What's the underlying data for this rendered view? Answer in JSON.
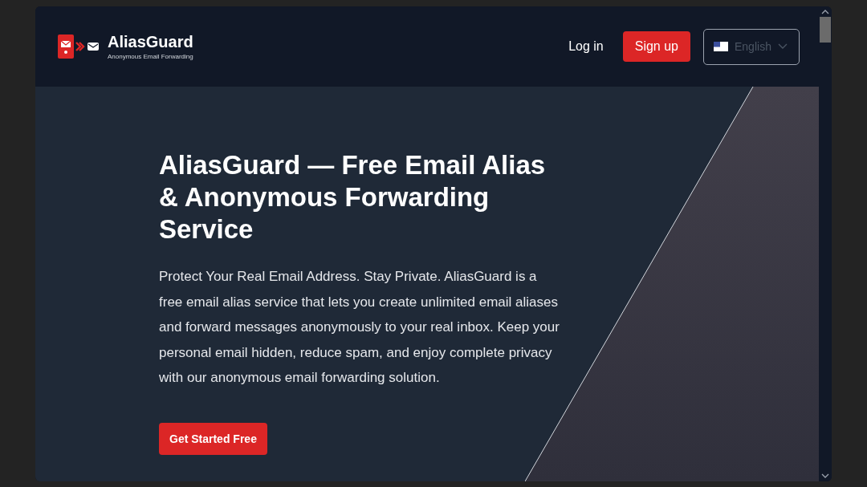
{
  "header": {
    "brand": "AliasGuard",
    "tagline": "Anonymous Email Forwarding",
    "login": "Log in",
    "signup": "Sign up",
    "language": {
      "value": "English",
      "disabled": true
    }
  },
  "hero": {
    "title": "AliasGuard — Free Email Alias & Anonymous Forwarding Service",
    "text": "Protect Your Real Email Address. Stay Private. AliasGuard is a free email alias service that lets you create unlimited email aliases and forward messages anonymously to your real inbox. Keep your personal email hidden, reduce spam, and enjoy complete privacy with our anonymous email forwarding solution.",
    "cta": "Get Started Free"
  }
}
